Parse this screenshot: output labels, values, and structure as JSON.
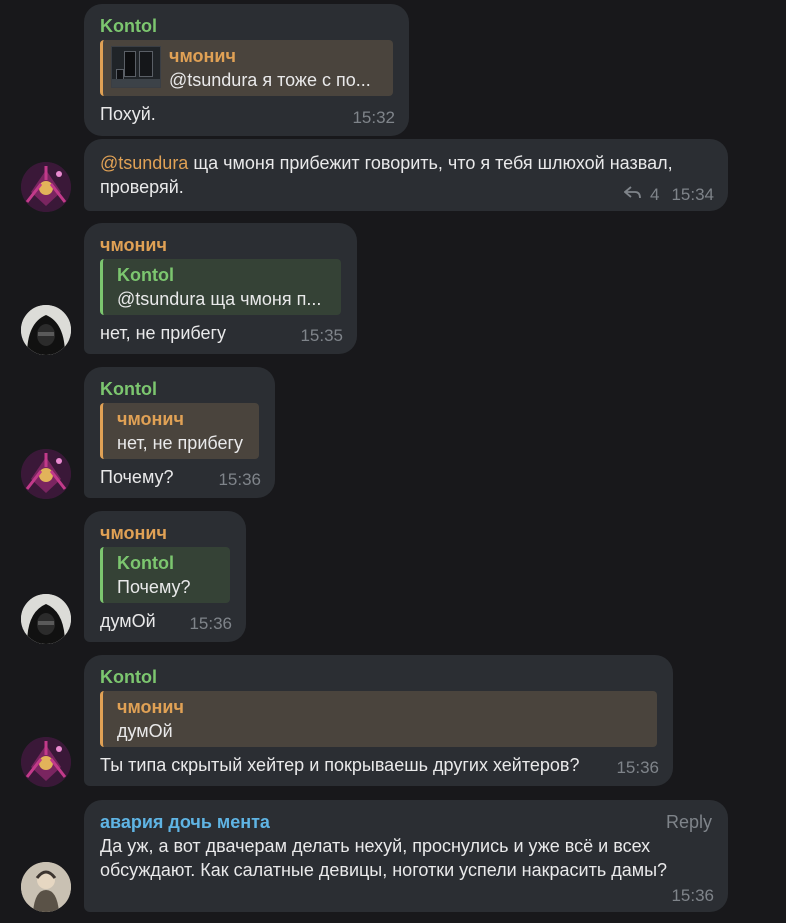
{
  "colors": {
    "background": "#18181b",
    "bubble": "#2b2e33",
    "green_name": "#7cc66f",
    "orange_name": "#e0a155",
    "blue_name": "#5fb4e4",
    "meta": "#7f848a"
  },
  "messages": [
    {
      "sender": "Kontol",
      "quote": {
        "name": "чмонич",
        "text": "@tsundura я тоже с по...",
        "thumb_icon": "image-thumbnail"
      },
      "text": "Похуй.",
      "time": "15:32"
    },
    {
      "mention": "@tsundura",
      "text": " ща чмоня прибежит говорить, что я тебя шлюхой назвал, проверяй.",
      "reply_count": "4",
      "reply_icon": "reply-arrow-icon",
      "time": "15:34",
      "avatar": "kontol-avatar"
    },
    {
      "sender": "чмонич",
      "quote": {
        "name": "Kontol",
        "text": "@tsundura ща чмоня п..."
      },
      "text": "нет, не прибегу",
      "time": "15:35",
      "avatar": "chmonich-avatar"
    },
    {
      "sender": "Kontol",
      "quote": {
        "name": "чмонич",
        "text": "нет, не прибегу"
      },
      "text": "Почему?",
      "time": "15:36",
      "avatar": "kontol-avatar"
    },
    {
      "sender": "чмонич",
      "quote": {
        "name": "Kontol",
        "text": "Почему?"
      },
      "text": "думОй",
      "time": "15:36",
      "avatar": "chmonich-avatar"
    },
    {
      "sender": "Kontol",
      "quote": {
        "name": "чмонич",
        "text": "думОй"
      },
      "text": "Ты типа скрытый хейтер и покрываешь других хейтеров?",
      "time": "15:36",
      "avatar": "kontol-avatar"
    },
    {
      "sender": "авария дочь мента",
      "reply_label": "Reply",
      "text": "Да уж, а вот двачерам делать нехуй, проснулись и уже всё и всех обсуждают. Как салатные девицы, ноготки успели накрасить дамы?",
      "time": "15:36",
      "avatar": "avaria-avatar"
    }
  ]
}
